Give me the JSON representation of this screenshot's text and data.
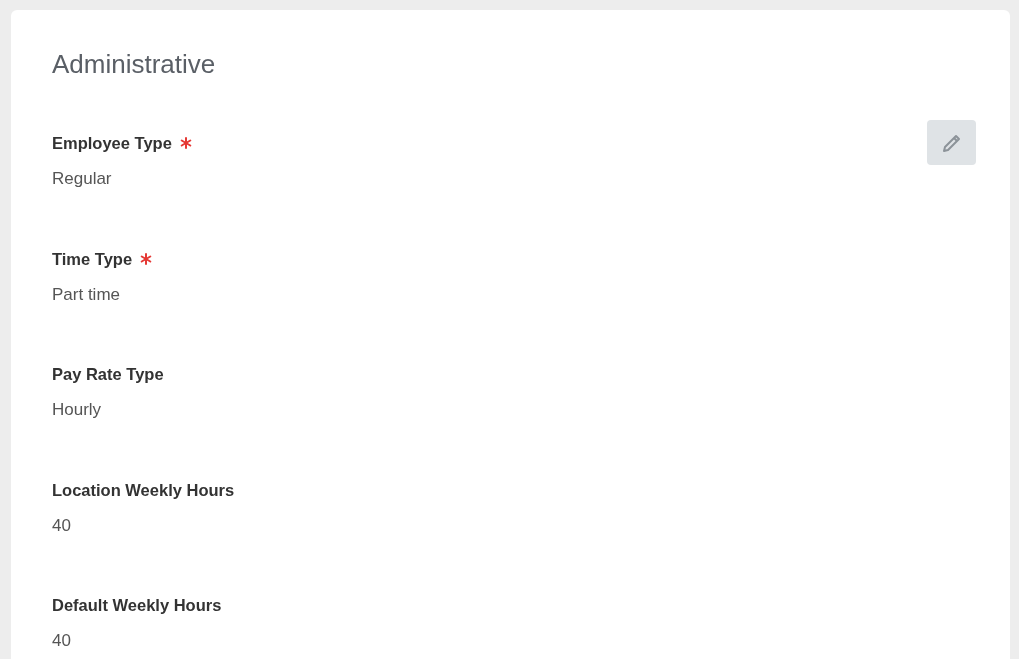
{
  "section": {
    "title": "Administrative",
    "edit_button": {
      "kind": "pencil"
    }
  },
  "fields": [
    {
      "label": "Employee Type",
      "required": true,
      "value": "Regular"
    },
    {
      "label": "Time Type",
      "required": true,
      "value": "Part time"
    },
    {
      "label": "Pay Rate Type",
      "required": false,
      "value": "Hourly"
    },
    {
      "label": "Location Weekly Hours",
      "required": false,
      "value": "40"
    },
    {
      "label": "Default Weekly Hours",
      "required": false,
      "value": "40"
    }
  ]
}
